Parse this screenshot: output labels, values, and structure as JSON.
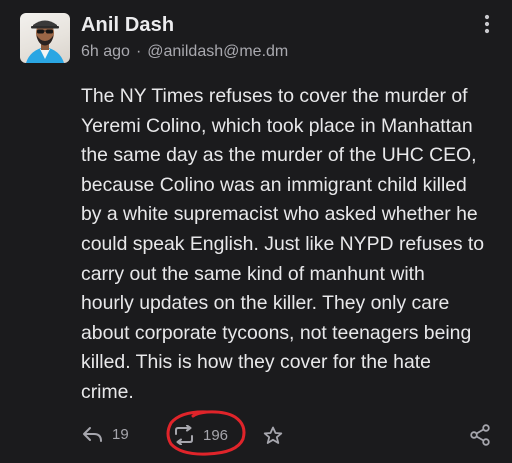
{
  "author": {
    "display_name": "Anil Dash",
    "time_ago": "6h ago",
    "separator": "·",
    "handle": "@anildash@me.dm",
    "avatar_icon": "profile-photo"
  },
  "post": {
    "lines": [
      "The NY Times refuses to cover the murder of",
      "Yeremi Colino, which took place in Manhattan",
      "the same day as the murder of the UHC CEO,",
      "because Colino was an immigrant child killed",
      "by a white supremacist who asked whether he",
      "could speak English. Just like NYPD refuses to",
      "carry out the same kind of manhunt with",
      "hourly updates on the killer. They only care",
      "about corporate tycoons, not teenagers being",
      "killed. This is how they cover for the hate",
      "crime."
    ]
  },
  "actions": {
    "reply_count": "19",
    "boost_count": "196",
    "icons": {
      "reply": "reply-icon",
      "boost": "boost-icon",
      "favorite": "star-icon",
      "share": "share-icon",
      "more": "more-vertical-icon"
    }
  },
  "colors": {
    "background": "#1b1b1d",
    "text": "#e8e8ea",
    "muted": "#a9a9af",
    "annotation": "#e0242a"
  }
}
